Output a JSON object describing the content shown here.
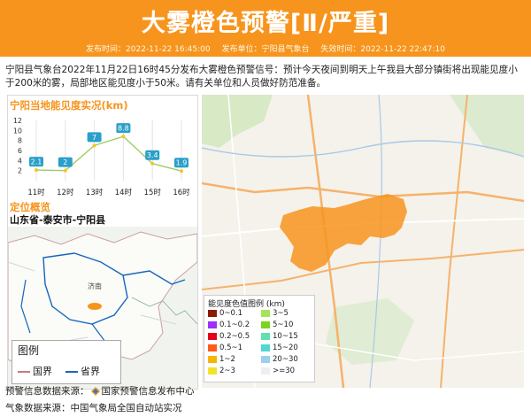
{
  "title": "大雾橙色预警[Ⅱ/严重]",
  "meta": {
    "issue_time": "发布时间：2022-11-22 16:45:00",
    "issuer": "发布单位：宁阳县气象台",
    "expire_time": "失效时间：2022-11-22 22:47:10"
  },
  "description": "宁阳县气象台2022年11月22日16时45分发布大雾橙色预警信号：预计今天夜间到明天上午我县大部分镇街将出现能见度小于200米的雾，局部地区能见度小于50米。请有关单位和人员做好防范准备。",
  "visibility_panel": {
    "title": "宁阳当地能见度实况(km)"
  },
  "location": {
    "title": "定位概览",
    "path": "山东省-泰安市-宁阳县"
  },
  "minimap": {
    "city_label": "济南",
    "legend_title": "图例",
    "legend_national": "国界",
    "legend_provincial": "省界"
  },
  "visibility_legend": {
    "title": "能见度色值图例 (km)",
    "items": [
      {
        "label": "0~0.1",
        "color": "#8b1a00"
      },
      {
        "label": "3~5",
        "color": "#a7e35a"
      },
      {
        "label": "0.1~0.2",
        "color": "#9b30ff"
      },
      {
        "label": "5~10",
        "color": "#7ed321"
      },
      {
        "label": "0.2~0.5",
        "color": "#e4001b"
      },
      {
        "label": "10~15",
        "color": "#5fe0b0"
      },
      {
        "label": "0.5~1",
        "color": "#ff5a1a"
      },
      {
        "label": "15~20",
        "color": "#4fd7d0"
      },
      {
        "label": "1~2",
        "color": "#f7b400"
      },
      {
        "label": "20~30",
        "color": "#9ad0ee"
      },
      {
        "label": "2~3",
        "color": "#f3e32a"
      },
      {
        "label": ">=30",
        "color": "#eeeeee"
      }
    ]
  },
  "footer": {
    "warning_source": "预警信息数据来源：",
    "warning_source_name": "国家预警信息发布中心",
    "weather_source": "气象数据来源：中国气象局全国自动站实况"
  },
  "colors": {
    "header": "#f7941d",
    "warning_area": "#f7941d",
    "line": "#9ccc65"
  },
  "chart_data": {
    "type": "line",
    "title": "宁阳当地能见度实况(km)",
    "categories": [
      "11时",
      "12时",
      "13时",
      "14时",
      "15时",
      "16时"
    ],
    "values": [
      2.1,
      2,
      7,
      8.8,
      3.4,
      1.9
    ],
    "y_ticks": [
      2,
      4,
      6,
      8,
      10,
      12
    ],
    "ylim": [
      0,
      12
    ],
    "grid": "vertical"
  }
}
